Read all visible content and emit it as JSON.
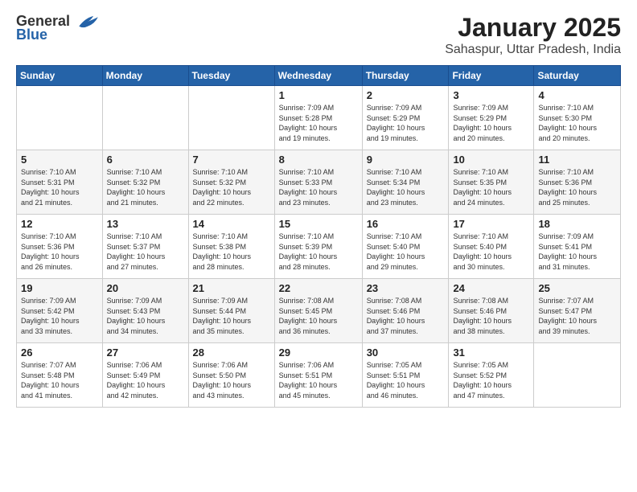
{
  "header": {
    "logo_general": "General",
    "logo_blue": "Blue",
    "title": "January 2025",
    "subtitle": "Sahaspur, Uttar Pradesh, India"
  },
  "weekdays": [
    "Sunday",
    "Monday",
    "Tuesday",
    "Wednesday",
    "Thursday",
    "Friday",
    "Saturday"
  ],
  "weeks": [
    [
      {
        "day": "",
        "info": ""
      },
      {
        "day": "",
        "info": ""
      },
      {
        "day": "",
        "info": ""
      },
      {
        "day": "1",
        "info": "Sunrise: 7:09 AM\nSunset: 5:28 PM\nDaylight: 10 hours\nand 19 minutes."
      },
      {
        "day": "2",
        "info": "Sunrise: 7:09 AM\nSunset: 5:29 PM\nDaylight: 10 hours\nand 19 minutes."
      },
      {
        "day": "3",
        "info": "Sunrise: 7:09 AM\nSunset: 5:29 PM\nDaylight: 10 hours\nand 20 minutes."
      },
      {
        "day": "4",
        "info": "Sunrise: 7:10 AM\nSunset: 5:30 PM\nDaylight: 10 hours\nand 20 minutes."
      }
    ],
    [
      {
        "day": "5",
        "info": "Sunrise: 7:10 AM\nSunset: 5:31 PM\nDaylight: 10 hours\nand 21 minutes."
      },
      {
        "day": "6",
        "info": "Sunrise: 7:10 AM\nSunset: 5:32 PM\nDaylight: 10 hours\nand 21 minutes."
      },
      {
        "day": "7",
        "info": "Sunrise: 7:10 AM\nSunset: 5:32 PM\nDaylight: 10 hours\nand 22 minutes."
      },
      {
        "day": "8",
        "info": "Sunrise: 7:10 AM\nSunset: 5:33 PM\nDaylight: 10 hours\nand 23 minutes."
      },
      {
        "day": "9",
        "info": "Sunrise: 7:10 AM\nSunset: 5:34 PM\nDaylight: 10 hours\nand 23 minutes."
      },
      {
        "day": "10",
        "info": "Sunrise: 7:10 AM\nSunset: 5:35 PM\nDaylight: 10 hours\nand 24 minutes."
      },
      {
        "day": "11",
        "info": "Sunrise: 7:10 AM\nSunset: 5:36 PM\nDaylight: 10 hours\nand 25 minutes."
      }
    ],
    [
      {
        "day": "12",
        "info": "Sunrise: 7:10 AM\nSunset: 5:36 PM\nDaylight: 10 hours\nand 26 minutes."
      },
      {
        "day": "13",
        "info": "Sunrise: 7:10 AM\nSunset: 5:37 PM\nDaylight: 10 hours\nand 27 minutes."
      },
      {
        "day": "14",
        "info": "Sunrise: 7:10 AM\nSunset: 5:38 PM\nDaylight: 10 hours\nand 28 minutes."
      },
      {
        "day": "15",
        "info": "Sunrise: 7:10 AM\nSunset: 5:39 PM\nDaylight: 10 hours\nand 28 minutes."
      },
      {
        "day": "16",
        "info": "Sunrise: 7:10 AM\nSunset: 5:40 PM\nDaylight: 10 hours\nand 29 minutes."
      },
      {
        "day": "17",
        "info": "Sunrise: 7:10 AM\nSunset: 5:40 PM\nDaylight: 10 hours\nand 30 minutes."
      },
      {
        "day": "18",
        "info": "Sunrise: 7:09 AM\nSunset: 5:41 PM\nDaylight: 10 hours\nand 31 minutes."
      }
    ],
    [
      {
        "day": "19",
        "info": "Sunrise: 7:09 AM\nSunset: 5:42 PM\nDaylight: 10 hours\nand 33 minutes."
      },
      {
        "day": "20",
        "info": "Sunrise: 7:09 AM\nSunset: 5:43 PM\nDaylight: 10 hours\nand 34 minutes."
      },
      {
        "day": "21",
        "info": "Sunrise: 7:09 AM\nSunset: 5:44 PM\nDaylight: 10 hours\nand 35 minutes."
      },
      {
        "day": "22",
        "info": "Sunrise: 7:08 AM\nSunset: 5:45 PM\nDaylight: 10 hours\nand 36 minutes."
      },
      {
        "day": "23",
        "info": "Sunrise: 7:08 AM\nSunset: 5:46 PM\nDaylight: 10 hours\nand 37 minutes."
      },
      {
        "day": "24",
        "info": "Sunrise: 7:08 AM\nSunset: 5:46 PM\nDaylight: 10 hours\nand 38 minutes."
      },
      {
        "day": "25",
        "info": "Sunrise: 7:07 AM\nSunset: 5:47 PM\nDaylight: 10 hours\nand 39 minutes."
      }
    ],
    [
      {
        "day": "26",
        "info": "Sunrise: 7:07 AM\nSunset: 5:48 PM\nDaylight: 10 hours\nand 41 minutes."
      },
      {
        "day": "27",
        "info": "Sunrise: 7:06 AM\nSunset: 5:49 PM\nDaylight: 10 hours\nand 42 minutes."
      },
      {
        "day": "28",
        "info": "Sunrise: 7:06 AM\nSunset: 5:50 PM\nDaylight: 10 hours\nand 43 minutes."
      },
      {
        "day": "29",
        "info": "Sunrise: 7:06 AM\nSunset: 5:51 PM\nDaylight: 10 hours\nand 45 minutes."
      },
      {
        "day": "30",
        "info": "Sunrise: 7:05 AM\nSunset: 5:51 PM\nDaylight: 10 hours\nand 46 minutes."
      },
      {
        "day": "31",
        "info": "Sunrise: 7:05 AM\nSunset: 5:52 PM\nDaylight: 10 hours\nand 47 minutes."
      },
      {
        "day": "",
        "info": ""
      }
    ]
  ]
}
